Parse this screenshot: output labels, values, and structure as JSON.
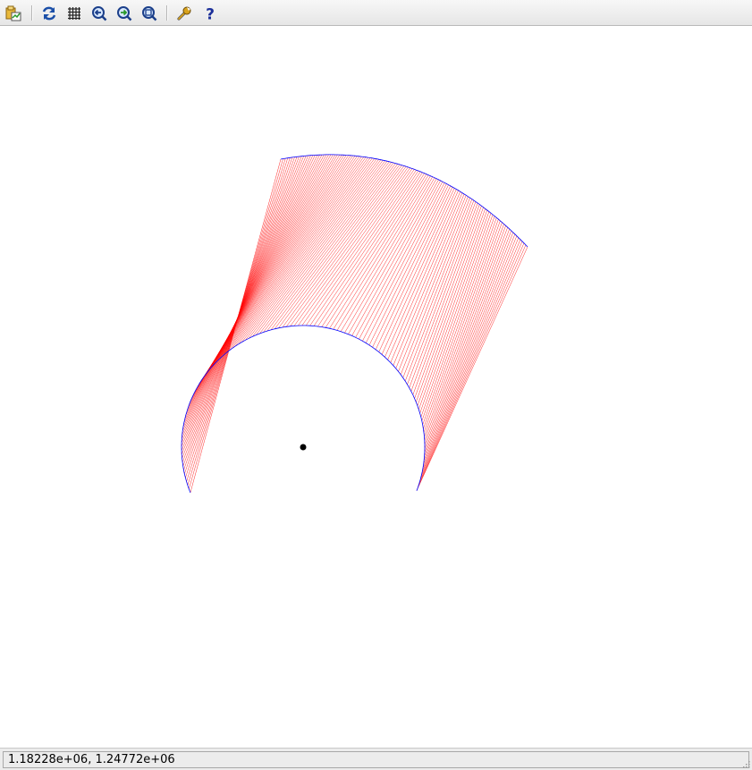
{
  "toolbar": {
    "buttons": [
      {
        "name": "open-file-icon"
      },
      {
        "name": "refresh-icon"
      },
      {
        "name": "grid-icon"
      },
      {
        "name": "zoom-back-icon"
      },
      {
        "name": "zoom-forward-icon"
      },
      {
        "name": "zoom-fit-icon"
      },
      {
        "name": "settings-wrench-icon"
      },
      {
        "name": "help-icon"
      }
    ]
  },
  "status": {
    "coordinates": "1.18228e+06,  1.24772e+06"
  },
  "colors": {
    "arc": "#0000ff",
    "rays": "#ff0000",
    "center_point": "#000000"
  }
}
